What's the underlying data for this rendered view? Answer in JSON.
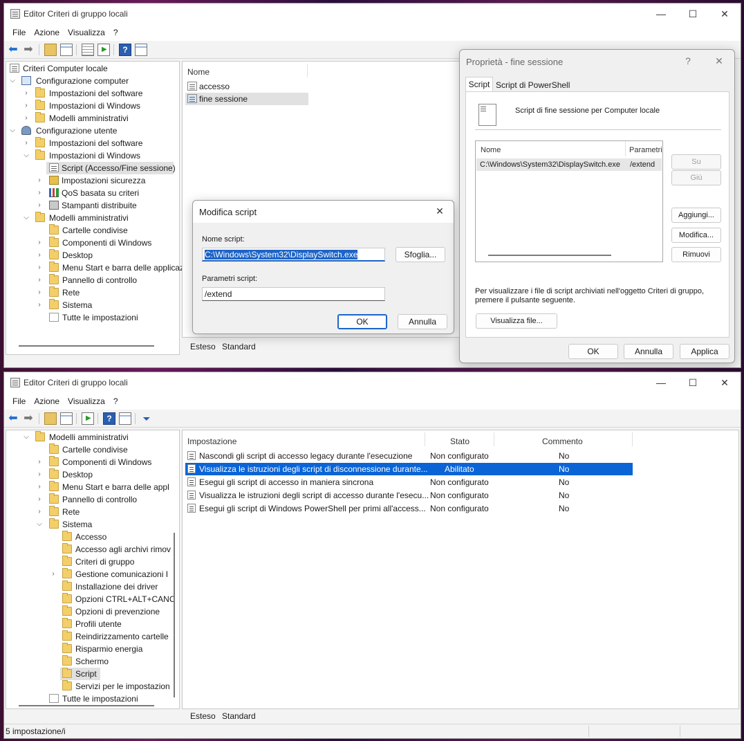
{
  "top_window": {
    "title": "Editor Criteri di gruppo locali",
    "menu": [
      "File",
      "Azione",
      "Visualizza",
      "?"
    ],
    "tree": [
      {
        "label": "Criteri Computer locale",
        "icon": "policy-icon"
      },
      {
        "label": "Configurazione computer",
        "icon": "computer-icon"
      },
      {
        "label": "Impostazioni del software",
        "icon": "folder-icon"
      },
      {
        "label": "Impostazioni di Windows",
        "icon": "folder-icon"
      },
      {
        "label": "Modelli amministrativi",
        "icon": "folder-icon"
      },
      {
        "label": "Configurazione utente",
        "icon": "user-icon"
      },
      {
        "label": "Impostazioni del software",
        "icon": "folder-icon"
      },
      {
        "label": "Impostazioni di Windows",
        "icon": "folder-icon"
      },
      {
        "label": "Script (Accesso/Fine sessione)",
        "icon": "script-icon"
      },
      {
        "label": "Impostazioni sicurezza",
        "icon": "shield-icon"
      },
      {
        "label": "QoS basata su criteri",
        "icon": "chart-icon"
      },
      {
        "label": "Stampanti distribuite",
        "icon": "printer-icon"
      },
      {
        "label": "Modelli amministrativi",
        "icon": "folder-icon"
      },
      {
        "label": "Cartelle condivise",
        "icon": "folder-icon"
      },
      {
        "label": "Componenti di Windows",
        "icon": "folder-icon"
      },
      {
        "label": "Desktop",
        "icon": "folder-icon"
      },
      {
        "label": "Menu Start e barra delle applicaz",
        "icon": "folder-icon"
      },
      {
        "label": "Pannello di controllo",
        "icon": "folder-icon"
      },
      {
        "label": "Rete",
        "icon": "folder-icon"
      },
      {
        "label": "Sistema",
        "icon": "folder-icon"
      },
      {
        "label": "Tutte le impostazioni",
        "icon": "settings-list-icon"
      }
    ],
    "list_header": "Nome",
    "list_items": [
      "accesso",
      "fine sessione"
    ],
    "tabs": [
      "Esteso",
      "Standard"
    ]
  },
  "edit_dialog": {
    "title": "Modifica script",
    "name_label": "Nome script:",
    "name_value": "C:\\Windows\\System32\\DisplaySwitch.exe",
    "browse": "Sfoglia...",
    "params_label": "Parametri script:",
    "params_value": "/extend",
    "ok": "OK",
    "cancel": "Annulla"
  },
  "props_dialog": {
    "title": "Proprietà - fine sessione",
    "help": "?",
    "tabs": [
      "Script",
      "Script di PowerShell"
    ],
    "heading": "Script di fine sessione per Computer locale",
    "col_name": "Nome",
    "col_params": "Parametri",
    "row_name": "C:\\Windows\\System32\\DisplaySwitch.exe",
    "row_params": "/extend",
    "up": "Su",
    "down": "Giù",
    "add": "Aggiungi...",
    "edit": "Modifica...",
    "remove": "Rimuovi",
    "info": "Per visualizzare i file di script archiviati nell'oggetto Criteri di gruppo, premere il pulsante seguente.",
    "show_files": "Visualizza file...",
    "ok": "OK",
    "cancel": "Annulla",
    "apply": "Applica"
  },
  "bottom_window": {
    "title": "Editor Criteri di gruppo locali",
    "menu": [
      "File",
      "Azione",
      "Visualizza",
      "?"
    ],
    "tree": [
      {
        "label": "Modelli amministrativi"
      },
      {
        "label": "Cartelle condivise"
      },
      {
        "label": "Componenti di Windows"
      },
      {
        "label": "Desktop"
      },
      {
        "label": "Menu Start e barra delle appl"
      },
      {
        "label": "Pannello di controllo"
      },
      {
        "label": "Rete"
      },
      {
        "label": "Sistema"
      },
      {
        "label": "Accesso"
      },
      {
        "label": "Accesso agli archivi rimov"
      },
      {
        "label": "Criteri di gruppo"
      },
      {
        "label": "Gestione comunicazioni I"
      },
      {
        "label": "Installazione dei driver"
      },
      {
        "label": "Opzioni CTRL+ALT+CANC"
      },
      {
        "label": "Opzioni di prevenzione"
      },
      {
        "label": "Profili utente"
      },
      {
        "label": "Reindirizzamento cartelle"
      },
      {
        "label": "Risparmio energia"
      },
      {
        "label": "Schermo"
      },
      {
        "label": "Script"
      },
      {
        "label": "Servizi per le impostazion"
      },
      {
        "label": "Tutte le impostazioni"
      }
    ],
    "columns": [
      "Impostazione",
      "Stato",
      "Commento"
    ],
    "rows": [
      {
        "setting": "Nascondi gli script di accesso legacy durante l'esecuzione",
        "state": "Non configurato",
        "comment": "No"
      },
      {
        "setting": "Visualizza le istruzioni degli script di disconnessione durante...",
        "state": "Abilitato",
        "comment": "No"
      },
      {
        "setting": "Esegui gli script di accesso in maniera sincrona",
        "state": "Non configurato",
        "comment": "No"
      },
      {
        "setting": "Visualizza le istruzioni degli script di accesso durante l'esecu...",
        "state": "Non configurato",
        "comment": "No"
      },
      {
        "setting": "Esegui gli script di Windows PowerShell per primi all'access...",
        "state": "Non configurato",
        "comment": "No"
      }
    ],
    "tabs": [
      "Esteso",
      "Standard"
    ],
    "status": "5 impostazione/i"
  },
  "window_controls": {
    "minimize": "—",
    "maximize": "☐",
    "close": "✕"
  }
}
